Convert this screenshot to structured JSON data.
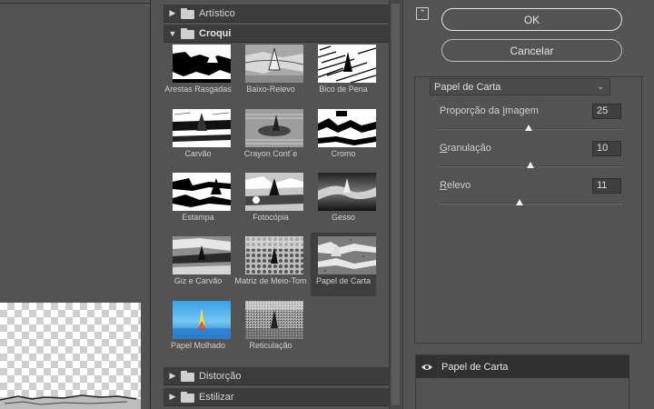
{
  "gallery": {
    "categories": {
      "artistic": "Artístico",
      "sketch": "Croqui",
      "distort": "Distorção",
      "stylize": "Estilizar"
    },
    "filters": [
      {
        "label": "Arestas Rasgadas"
      },
      {
        "label": "Baixo-Relevo"
      },
      {
        "label": "Bico de Pena"
      },
      {
        "label": "Carvão"
      },
      {
        "label": "Crayon Cont´e"
      },
      {
        "label": "Cromo"
      },
      {
        "label": "Estampa"
      },
      {
        "label": "Fotocópia"
      },
      {
        "label": "Gesso"
      },
      {
        "label": "Giz e Carvão"
      },
      {
        "label": "Matriz de Meio-Tom"
      },
      {
        "label": "Papel de Carta"
      },
      {
        "label": "Papel Molhado"
      },
      {
        "label": "Reticulação"
      }
    ],
    "selected": "Papel de Carta"
  },
  "buttons": {
    "ok": "OK",
    "cancel": "Cancelar"
  },
  "settings": {
    "filter_select": "Papel de Carta",
    "params": [
      {
        "label_pre": "Proporção da ",
        "label_u": "I",
        "label_post": "magem",
        "value": "25",
        "min": 1,
        "max": 50
      },
      {
        "label_pre": "",
        "label_u": "G",
        "label_post": "ranulação",
        "value": "10",
        "min": 0,
        "max": 20
      },
      {
        "label_pre": "",
        "label_u": "R",
        "label_post": "elevo",
        "value": "11",
        "min": 0,
        "max": 25
      }
    ]
  },
  "layers": {
    "active": "Papel de Carta"
  },
  "icons": {
    "collapse": "collapse-up-icon",
    "eye": "eye-icon",
    "folder": "folder-icon",
    "expand": "triangle-right-icon",
    "expanded": "triangle-down-icon",
    "select_arrow": "chevron-down-icon"
  },
  "colors": {
    "background": "#535353",
    "category_bar": "#3c3c3c",
    "selected_filter": "#3e3e3e",
    "layer_row": "#303030"
  }
}
